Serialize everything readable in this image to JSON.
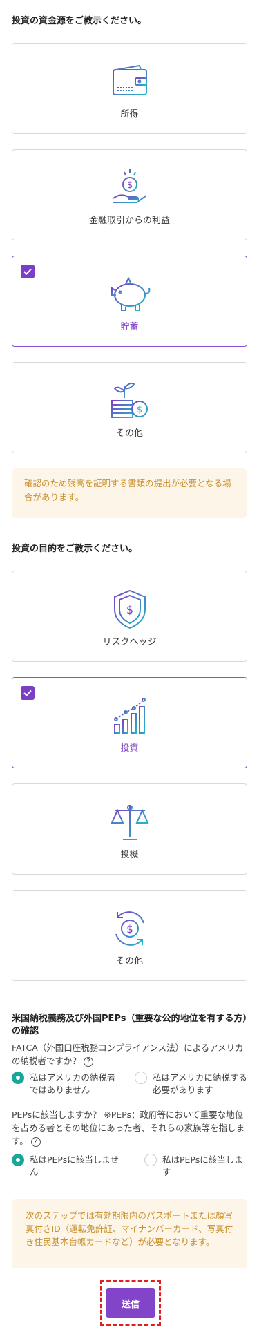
{
  "funding": {
    "heading": "投資の資金源をご教示ください。",
    "options": [
      {
        "label": "所得",
        "icon": "wallet-icon",
        "selected": false
      },
      {
        "label": "金融取引からの利益",
        "icon": "coin-hand-icon",
        "selected": false
      },
      {
        "label": "貯蓄",
        "icon": "piggy-bank-icon",
        "selected": true
      },
      {
        "label": "その他",
        "icon": "plant-coin-icon",
        "selected": false
      }
    ],
    "notice": "確認のため残高を証明する書類の提出が必要となる場合があります。"
  },
  "purpose": {
    "heading": "投資の目的をご教示ください。",
    "options": [
      {
        "label": "リスクヘッジ",
        "icon": "shield-dollar-icon",
        "selected": false
      },
      {
        "label": "投資",
        "icon": "growth-chart-icon",
        "selected": true
      },
      {
        "label": "投機",
        "icon": "scales-icon",
        "selected": false
      },
      {
        "label": "その他",
        "icon": "cycle-dollar-icon",
        "selected": false
      }
    ]
  },
  "tax": {
    "heading": "米国納税義務及び外国PEPs（重要な公的地位を有する方）の確認",
    "fatca_question": "FATCA（外国口座税務コンプライアンス法）によるアメリカの納税者ですか？",
    "fatca_options": [
      "私はアメリカの納税者ではありません",
      "私はアメリカに納税する必要があります"
    ],
    "fatca_selected": 0,
    "peps_question": "PEPsに該当しますか？ ※PEPs：政府等において重要な地位を占める者とその地位にあった者、それらの家族等を指します。",
    "peps_options": [
      "私はPEPsに該当しません",
      "私はPEPsに該当します"
    ],
    "peps_selected": 0,
    "help_glyph": "?"
  },
  "next_notice": "次のステップでは有効期限内のパスポートまたは顔写真付きID（運転免許証、マイナンバーカード、写真付き住民基本台帳カードなど）が必要となります。",
  "submit_label": "送信",
  "colors": {
    "accent": "#7b3fc6",
    "radio": "#1aa59b",
    "notice_bg": "#fdf5e8",
    "notice_text": "#c8902e",
    "highlight": "#e02020"
  }
}
